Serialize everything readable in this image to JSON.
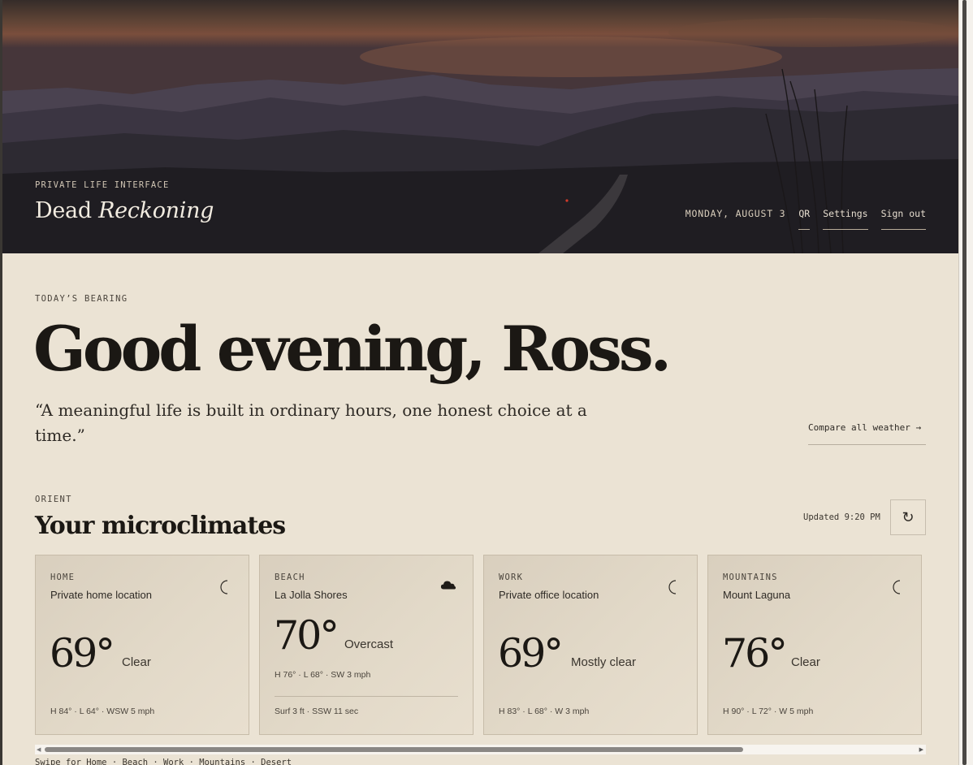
{
  "header": {
    "eyebrow": "PRIVATE LIFE INTERFACE",
    "brand_plain": "Dead",
    "brand_italic": "Reckoning",
    "date": "MONDAY, AUGUST 3",
    "nav": [
      "QR",
      "Settings",
      "Sign out"
    ]
  },
  "main": {
    "bearing_label": "TODAY’S BEARING",
    "greeting": "Good evening, Ross.",
    "quote": "“A meaningful life is built in ordinary hours, one honest choice at a time.”",
    "compare_link": "Compare all weather →"
  },
  "microclimates": {
    "eyebrow": "ORIENT",
    "title": "Your microclimates",
    "updated": "Updated 9:20 PM",
    "refresh_icon": "refresh-icon",
    "cards": [
      {
        "kind": "HOME",
        "place": "Private home location",
        "icon": "moon-icon",
        "temp": "69°",
        "condition": "Clear",
        "details": "H 84° · L 64° · WSW 5 mph",
        "extra": ""
      },
      {
        "kind": "BEACH",
        "place": "La Jolla Shores",
        "icon": "cloud-icon",
        "temp": "70°",
        "condition": "Overcast",
        "details": "H 76° · L 68° · SW 3 mph",
        "extra": "Surf 3 ft · SSW 11 sec"
      },
      {
        "kind": "WORK",
        "place": "Private office location",
        "icon": "moon-icon",
        "temp": "69°",
        "condition": "Mostly clear",
        "details": "H 83° · L 68° · W 3 mph",
        "extra": ""
      },
      {
        "kind": "MOUNTAINS",
        "place": "Mount Laguna",
        "icon": "moon-icon",
        "temp": "76°",
        "condition": "Clear",
        "details": "H 90° · L 72° · W 5 mph",
        "extra": ""
      }
    ],
    "swipe_hint": "Swipe for Home · Beach · Work · Mountains · Desert"
  }
}
